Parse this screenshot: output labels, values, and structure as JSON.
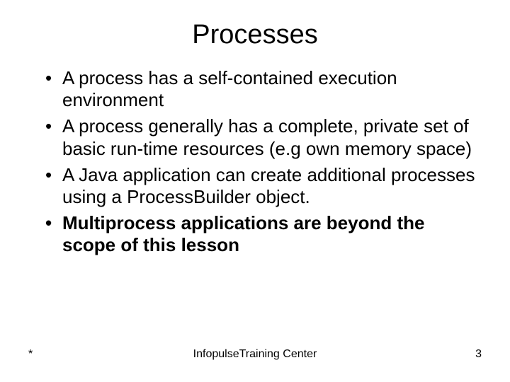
{
  "title": "Processes",
  "bullets": [
    {
      "text": "A process has a self-contained execution environment",
      "bold": false
    },
    {
      "text": "A process generally has a complete, private set of basic run-time resources (e.g own memory space)",
      "bold": false
    },
    {
      "text": "A Java application can create additional processes using a  ProcessBuilder object.",
      "bold": false
    },
    {
      "text": "Multiprocess applications are beyond the scope of this lesson",
      "bold": true
    }
  ],
  "footer": {
    "left": "*",
    "center": "InfopulseTraining Center",
    "right": "3"
  }
}
